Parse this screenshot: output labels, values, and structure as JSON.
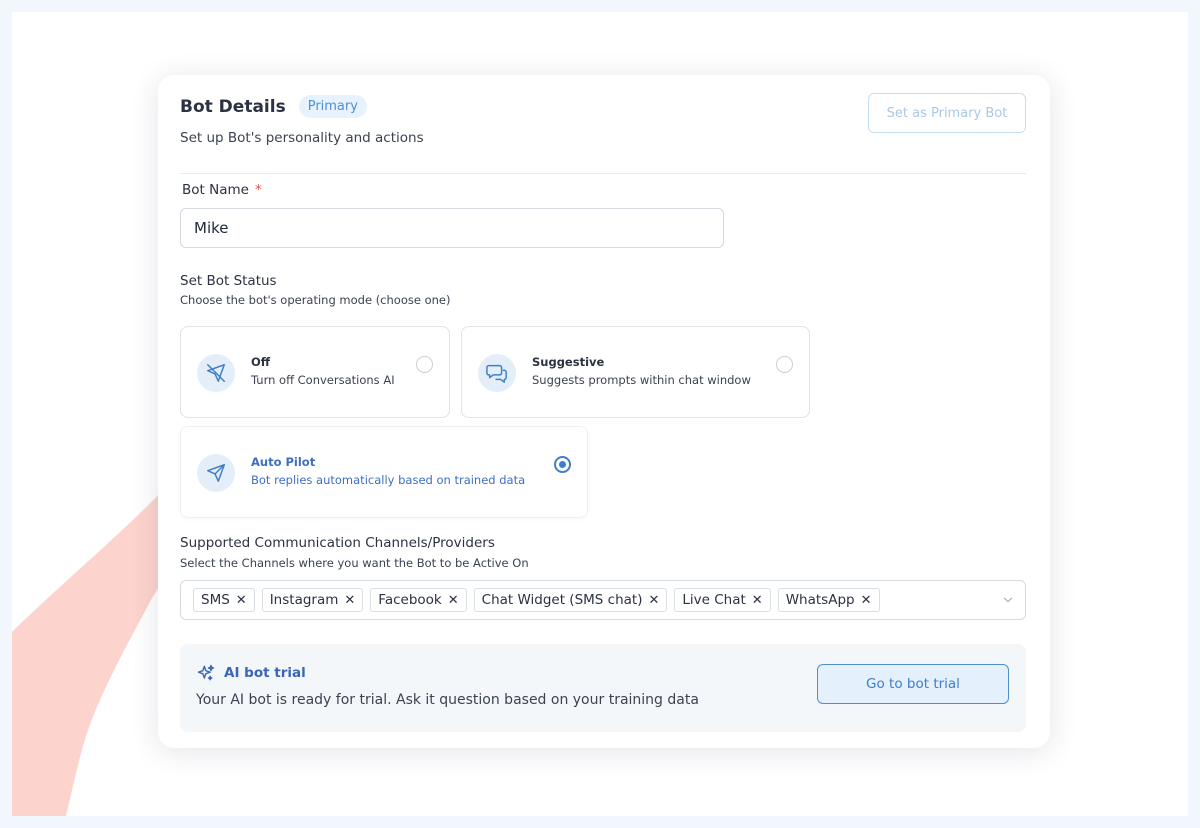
{
  "header": {
    "title": "Bot Details",
    "badge": "Primary",
    "subtitle": "Set up Bot's personality and actions",
    "set_primary_label": "Set as Primary Bot"
  },
  "bot_name": {
    "label": "Bot Name",
    "required_mark": "*",
    "value": "Mike"
  },
  "status": {
    "label": "Set Bot Status",
    "help": "Choose the bot's operating mode (choose one)",
    "options": [
      {
        "icon": "send-off-icon",
        "title": "Off",
        "desc": "Turn off Conversations AI",
        "selected": false
      },
      {
        "icon": "chat-bubbles-icon",
        "title": "Suggestive",
        "desc": "Suggests prompts within chat window",
        "selected": false
      },
      {
        "icon": "send-icon",
        "title": "Auto Pilot",
        "desc": "Bot replies automatically based on trained data",
        "selected": true
      }
    ]
  },
  "channels": {
    "label": "Supported Communication Channels/Providers",
    "help": "Select the Channels where you want the Bot to be Active On",
    "selected": [
      "SMS",
      "Instagram",
      "Facebook",
      "Chat Widget (SMS chat)",
      "Live Chat",
      "WhatsApp"
    ],
    "remove_glyph": "✕"
  },
  "trial": {
    "icon": "sparkles-icon",
    "title": "AI bot trial",
    "desc": "Your AI bot is ready for trial. Ask it question based on your training data",
    "button_label": "Go to bot trial"
  },
  "colors": {
    "accent": "#3f7fc9",
    "badge_bg": "#e7f2fc",
    "hand": "#fdd3cd",
    "trial_bg": "#f4f7fa"
  }
}
